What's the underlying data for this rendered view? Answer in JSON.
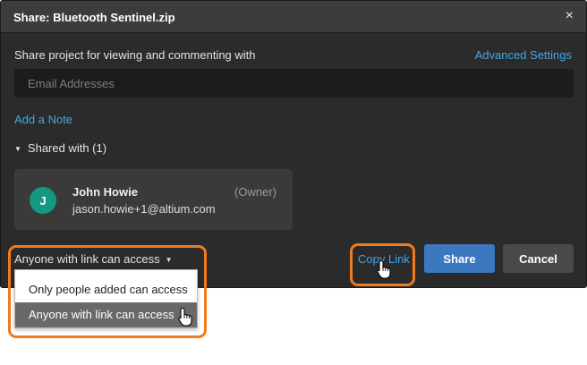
{
  "dialog": {
    "title": "Share: Bluetooth Sentinel.zip",
    "close_glyph": "×",
    "close_icon": "close-icon"
  },
  "share": {
    "description": "Share project for viewing and commenting with",
    "advanced_settings": "Advanced Settings",
    "email_placeholder": "Email Addresses",
    "add_note": "Add a Note"
  },
  "shared_with": {
    "caret": "▼",
    "label": "Shared with (1)",
    "users": [
      {
        "initial": "J",
        "name": "John Howie",
        "email": "jason.howie+1@altium.com",
        "role": "(Owner)",
        "avatar_color": "#149783"
      }
    ]
  },
  "access": {
    "selected": "Anyone with link can access",
    "caret": "▼",
    "options": [
      "Only people added can access",
      "Anyone with link can access"
    ],
    "highlighted_option": "Anyone with link can access"
  },
  "actions": {
    "copy_link": "Copy Link",
    "share": "Share",
    "cancel": "Cancel"
  },
  "colors": {
    "accent_link": "#3fa9e6",
    "primary_button": "#3b78c0",
    "highlight_outline": "#f07b1b",
    "dialog_bg": "#2b2b2b"
  }
}
